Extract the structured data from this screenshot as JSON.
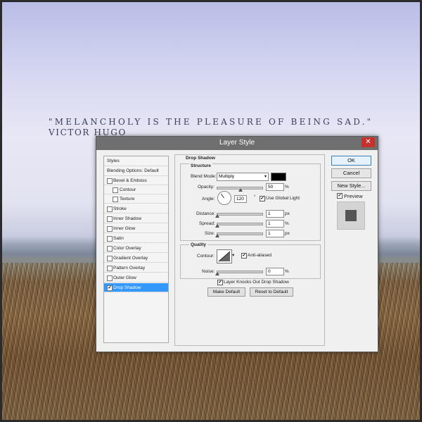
{
  "background": {
    "quote": "\"MELANCHOLY IS THE PLEASURE OF BEING SAD.\"",
    "author": "VICTOR HUGO"
  },
  "dialog": {
    "title": "Layer Style",
    "close_glyph": "✕",
    "styles_header": "Styles",
    "blending_options": "Blending Options: Default",
    "style_items": [
      {
        "label": "Bevel & Emboss",
        "checked": false
      },
      {
        "label": "Contour",
        "checked": false
      },
      {
        "label": "Texture",
        "checked": false
      },
      {
        "label": "Stroke",
        "checked": false
      },
      {
        "label": "Inner Shadow",
        "checked": false
      },
      {
        "label": "Inner Glow",
        "checked": false
      },
      {
        "label": "Satin",
        "checked": false
      },
      {
        "label": "Color Overlay",
        "checked": false
      },
      {
        "label": "Gradient Overlay",
        "checked": false
      },
      {
        "label": "Pattern Overlay",
        "checked": false
      },
      {
        "label": "Outer Glow",
        "checked": false
      },
      {
        "label": "Drop Shadow",
        "checked": true
      }
    ],
    "section_title": "Drop Shadow",
    "structure": {
      "heading": "Structure",
      "blend_mode_label": "Blend Mode:",
      "blend_mode_value": "Multiply",
      "shadow_color": "#000000",
      "opacity_label": "Opacity:",
      "opacity_value": "50",
      "opacity_unit": "%",
      "angle_label": "Angle:",
      "angle_value": "120",
      "angle_unit": "°",
      "use_global_light_label": "Use Global Light",
      "use_global_light_checked": true,
      "distance_label": "Distance:",
      "distance_value": "1",
      "distance_unit": "px",
      "spread_label": "Spread:",
      "spread_value": "1",
      "spread_unit": "%",
      "size_label": "Size:",
      "size_value": "1",
      "size_unit": "px"
    },
    "quality": {
      "heading": "Quality",
      "contour_label": "Contour:",
      "anti_aliased_label": "Anti-aliased",
      "anti_aliased_checked": true,
      "noise_label": "Noise:",
      "noise_value": "0",
      "noise_unit": "%"
    },
    "knocks_out_label": "Layer Knocks Out Drop Shadow",
    "knocks_out_checked": true,
    "make_default": "Make Default",
    "reset_default": "Reset to Default",
    "ok": "OK",
    "cancel": "Cancel",
    "new_style": "New Style...",
    "preview_label": "Preview",
    "preview_checked": true,
    "check_glyph": "✔"
  }
}
